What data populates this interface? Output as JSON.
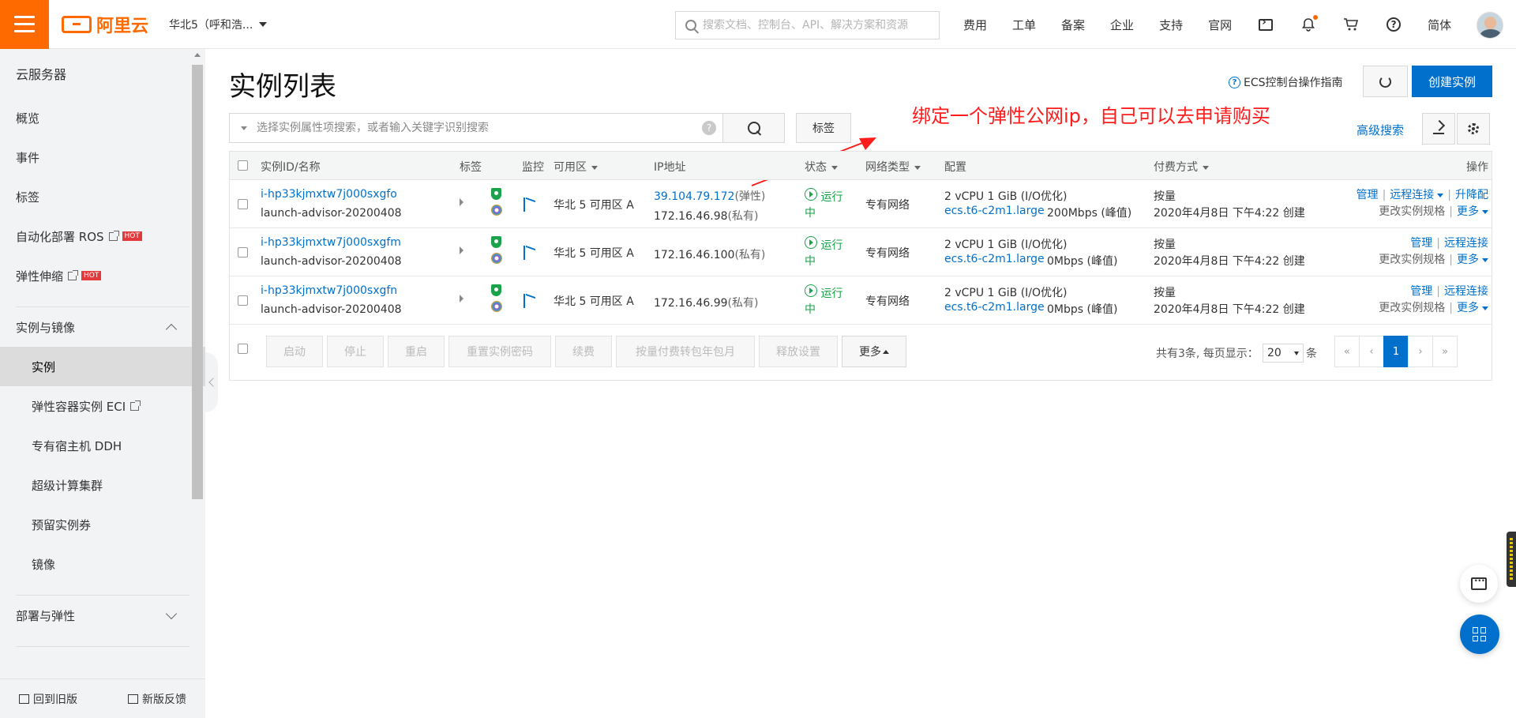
{
  "topbar": {
    "brand": "阿里云",
    "region": "华北5（呼和浩...",
    "search_placeholder": "搜索文档、控制台、API、解决方案和资源",
    "nav": [
      "费用",
      "工单",
      "备案",
      "企业",
      "支持",
      "官网"
    ],
    "lang": "简体",
    "accent": "#ff6a00"
  },
  "sidebar": {
    "title": "云服务器",
    "items_top": [
      {
        "label": "概览"
      },
      {
        "label": "事件"
      },
      {
        "label": "标签"
      },
      {
        "label": "自动化部署 ROS",
        "badge": "HOT"
      },
      {
        "label": "弹性伸缩",
        "badge": "HOT"
      }
    ],
    "group1": "实例与镜像",
    "group1_items": [
      "实例",
      "弹性容器实例 ECI",
      "专有宿主机 DDH",
      "超级计算集群",
      "预留实例券",
      "镜像"
    ],
    "group2": "部署与弹性",
    "bottom_left": "回到旧版",
    "bottom_right": "新版反馈"
  },
  "main": {
    "title": "实例列表",
    "guide": "ECS控制台操作指南",
    "create_label": "创建实例",
    "filter_placeholder": "选择实例属性项搜索，或者输入关键字识别搜索",
    "tag_button": "标签",
    "advanced_search": "高级搜索",
    "annotation": "绑定一个弹性公网ip，自己可以去申请购买",
    "brand_blue": "#0070cc"
  },
  "table": {
    "headers": {
      "id": "实例ID/名称",
      "tag": "标签",
      "monitor": "监控",
      "zone": "可用区",
      "ip": "IP地址",
      "status": "状态",
      "network": "网络类型",
      "config": "配置",
      "billing": "付费方式",
      "ops": "操作"
    },
    "rows": [
      {
        "id": "i-hp33kjmxtw7j000sxgfo",
        "name": "launch-advisor-20200408",
        "zone": "华北 5 可用区 A",
        "ip_public": "39.104.79.172",
        "ip_public_tag": "(弹性)",
        "ip_private": "172.16.46.98",
        "ip_private_tag": "(私有)",
        "status_1": "运行",
        "status_2": "中",
        "network": "专有网络",
        "config_1": "2 vCPU 1 GiB (I/O优化)",
        "spec": "ecs.t6-c2m1.large",
        "bandwidth": "200Mbps (峰值)",
        "billing": "按量",
        "created": "2020年4月8日 下午4:22 创建",
        "op_manage": "管理",
        "op_remote": "远程连接",
        "op_extra": "升降配",
        "op_change": "更改实例规格",
        "op_more": "更多"
      },
      {
        "id": "i-hp33kjmxtw7j000sxgfm",
        "name": "launch-advisor-20200408",
        "zone": "华北 5 可用区 A",
        "ip_private": "172.16.46.100",
        "ip_private_tag": "(私有)",
        "status_1": "运行",
        "status_2": "中",
        "network": "专有网络",
        "config_1": "2 vCPU 1 GiB (I/O优化)",
        "spec": "ecs.t6-c2m1.large",
        "bandwidth": "0Mbps (峰值)",
        "billing": "按量",
        "created": "2020年4月8日 下午4:22 创建",
        "op_manage": "管理",
        "op_remote": "远程连接",
        "op_change": "更改实例规格",
        "op_more": "更多"
      },
      {
        "id": "i-hp33kjmxtw7j000sxgfn",
        "name": "launch-advisor-20200408",
        "zone": "华北 5 可用区 A",
        "ip_private": "172.16.46.99",
        "ip_private_tag": "(私有)",
        "status_1": "运行",
        "status_2": "中",
        "network": "专有网络",
        "config_1": "2 vCPU 1 GiB (I/O优化)",
        "spec": "ecs.t6-c2m1.large",
        "bandwidth": "0Mbps (峰值)",
        "billing": "按量",
        "created": "2020年4月8日 下午4:22 创建",
        "op_manage": "管理",
        "op_remote": "远程连接",
        "op_change": "更改实例规格",
        "op_more": "更多"
      }
    ],
    "footer_buttons": [
      "启动",
      "停止",
      "重启",
      "重置实例密码",
      "续费",
      "按量付费转包年包月",
      "释放设置",
      "更多"
    ],
    "pager_text": "共有3条, 每页显示：",
    "page_size": "20",
    "pager_unit": "条",
    "pages": [
      "«",
      "‹",
      "1",
      "›",
      "»"
    ]
  }
}
